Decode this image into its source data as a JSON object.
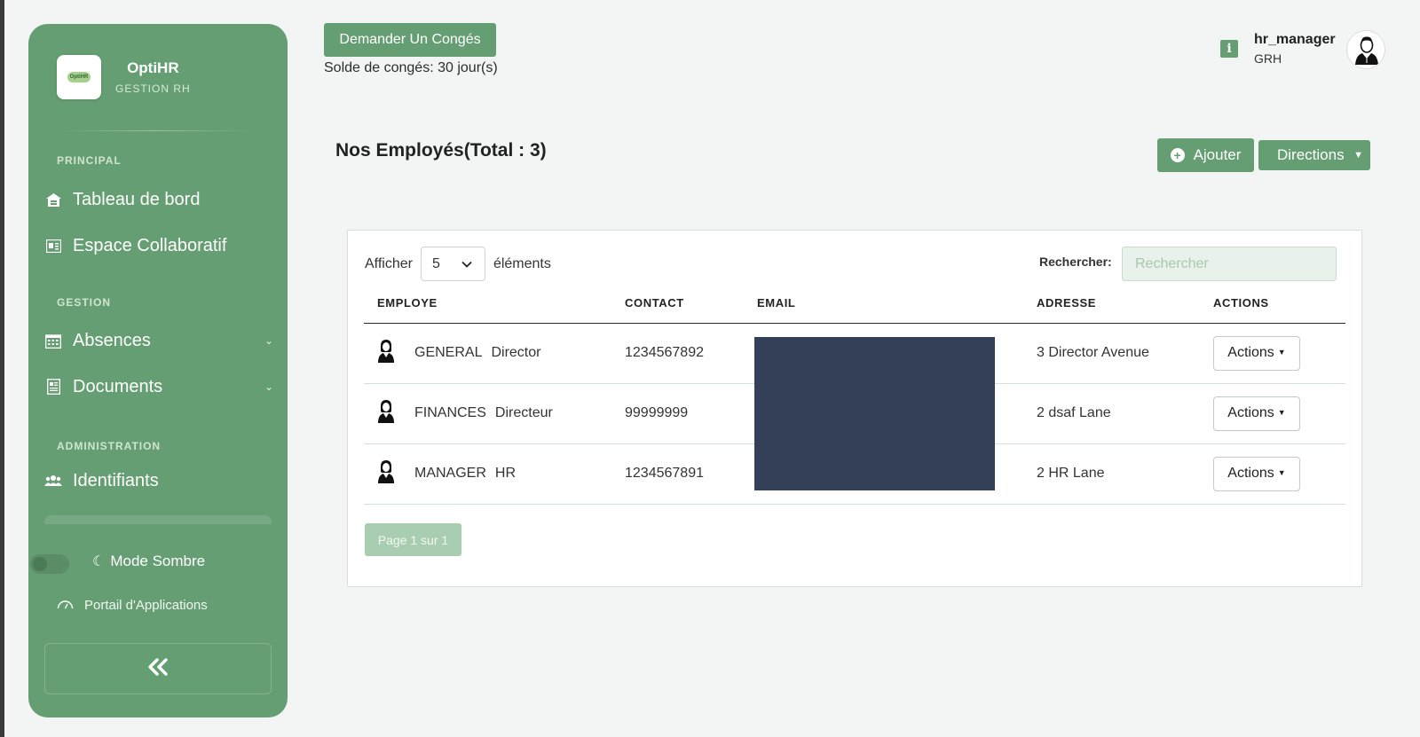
{
  "sidebar": {
    "brand": {
      "name": "OptiHR",
      "subtitle": "GESTION RH",
      "logo_text": "OptiHR"
    },
    "sections": {
      "principal": "PRINCIPAL",
      "gestion": "GESTION",
      "administration": "ADMINISTRATION"
    },
    "items": [
      {
        "label": "Tableau de bord",
        "icon": "home-icon"
      },
      {
        "label": "Espace Collaboratif",
        "icon": "newspaper-icon"
      },
      {
        "label": "Absences",
        "icon": "calendar-icon"
      },
      {
        "label": "Documents",
        "icon": "document-icon"
      },
      {
        "label": "Identifiants",
        "icon": "users-icon"
      }
    ],
    "dark_mode_label": "Mode Sombre",
    "portal_label": "Portail d'Applications",
    "collapse_glyph": "«"
  },
  "topbar": {
    "leave_button": "Demander Un Congés",
    "leave_balance": "Solde de congés: 30 jour(s)",
    "info_glyph": "i",
    "user": {
      "name": "hr_manager",
      "role": "GRH"
    }
  },
  "main": {
    "title": "Nos Employés(Total : 3)",
    "add_button": "Ajouter",
    "directions_button": "Directions",
    "show_label": "Afficher",
    "show_value": "5",
    "elements_label": "éléments",
    "search_label": "Rechercher:",
    "search_placeholder": "Rechercher",
    "search_value": "",
    "columns": [
      "EMPLOYE",
      "CONTACT",
      "EMAIL",
      "ADRESSE",
      "ACTIONS"
    ],
    "rows": [
      {
        "first": "GENERAL",
        "last": "Director",
        "contact": "1234567892",
        "email": "",
        "address": "3 Director Avenue",
        "action": "Actions"
      },
      {
        "first": "FINANCES",
        "last": "Directeur",
        "contact": "99999999",
        "email": "",
        "address": "2 dsaf Lane",
        "action": "Actions"
      },
      {
        "first": "MANAGER",
        "last": "HR",
        "contact": "1234567891",
        "email": "",
        "address": "2 HR Lane",
        "action": "Actions"
      }
    ],
    "pager": "Page 1 sur 1"
  },
  "colors": {
    "accent": "#669e73",
    "redaction": "#334057",
    "background": "#f3f5f4"
  }
}
